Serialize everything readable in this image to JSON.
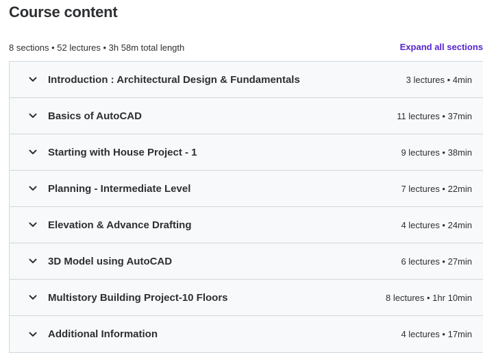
{
  "header": {
    "title": "Course content",
    "summary": "8 sections • 52 lectures • 3h 58m total length",
    "expand_label": "Expand all sections"
  },
  "icons": {
    "chevron": "chevron-down-icon"
  },
  "colors": {
    "accent": "#5624d0",
    "section_bg": "#f7f9fa",
    "border": "#d1d7dc",
    "text": "#2d2f31"
  },
  "sections": [
    {
      "title": "Introduction : Architectural Design & Fundamentals",
      "info": "3 lectures • 4min"
    },
    {
      "title": "Basics of AutoCAD",
      "info": "11 lectures • 37min"
    },
    {
      "title": "Starting with House Project - 1",
      "info": "9 lectures • 38min"
    },
    {
      "title": "Planning - Intermediate Level",
      "info": "7 lectures • 22min"
    },
    {
      "title": "Elevation & Advance Drafting",
      "info": "4 lectures • 24min"
    },
    {
      "title": "3D Model using AutoCAD",
      "info": "6 lectures • 27min"
    },
    {
      "title": "Multistory Building Project-10 Floors",
      "info": "8 lectures • 1hr 10min"
    },
    {
      "title": "Additional Information",
      "info": "4 lectures • 17min"
    }
  ]
}
